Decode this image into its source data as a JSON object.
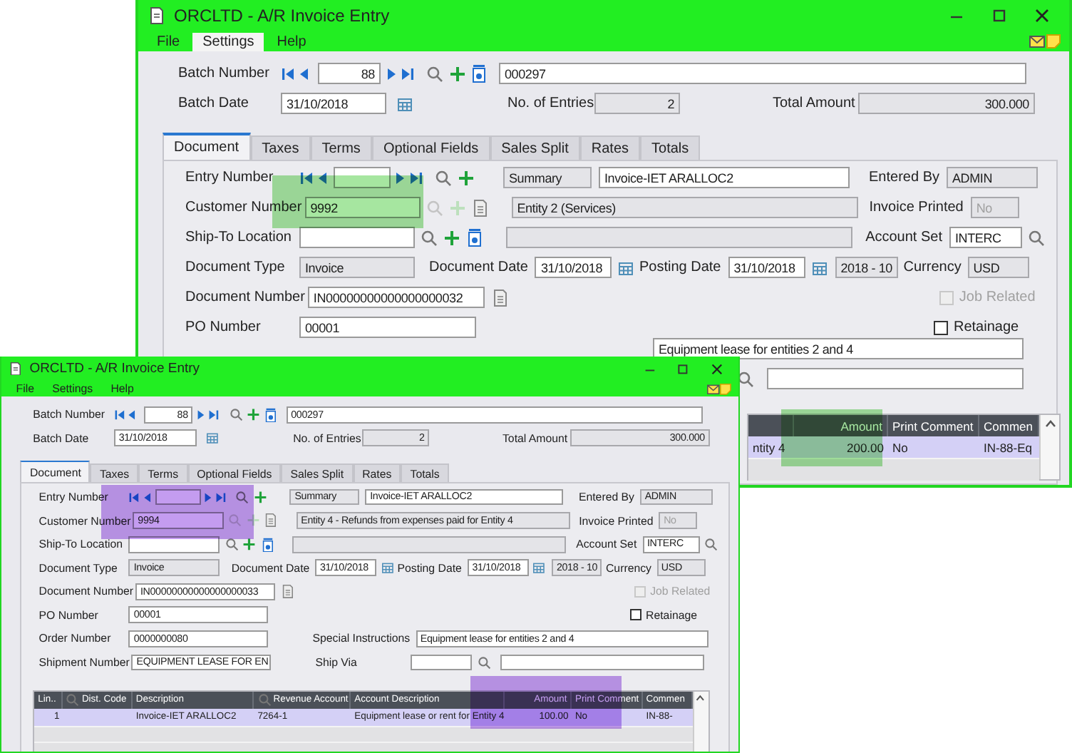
{
  "windows": [
    {
      "kind": "partial",
      "color": "#a6e6a0",
      "title": "ORCLTD - A/R Invoice Entry",
      "menu": [
        {
          "label": "File",
          "selected": false
        },
        {
          "label": "Settings",
          "selected": true
        },
        {
          "label": "Help",
          "selected": false
        }
      ],
      "batch": {
        "number_label": "Batch Number",
        "number": "88",
        "description": "000297",
        "date_label": "Batch Date",
        "date": "31/10/2018",
        "entries_label": "No. of Entries",
        "entries": "2",
        "total_label": "Total Amount",
        "total": "300.000"
      },
      "tabs": [
        {
          "label": "Document",
          "selected": true
        },
        {
          "label": "Taxes",
          "selected": false
        },
        {
          "label": "Terms",
          "selected": false
        },
        {
          "label": "Optional Fields",
          "selected": false
        },
        {
          "label": "Sales Split",
          "selected": false
        },
        {
          "label": "Rates",
          "selected": false
        },
        {
          "label": "Totals",
          "selected": false
        }
      ],
      "document": {
        "entry_number": {
          "label": "Entry Number"
        },
        "summary_label": "Summary",
        "summary": "Invoice-IET ARALLOC2",
        "entered_by": {
          "label": "Entered By",
          "value": "ADMIN"
        },
        "customer_number": {
          "label": "Customer Number",
          "value": "9992"
        },
        "customer_name": "Entity 2 (Services)",
        "invoice_printed": {
          "label": "Invoice Printed",
          "value": "No",
          "disabled": true
        },
        "ship_to": {
          "label": "Ship-To Location"
        },
        "account_set": {
          "label": "Account Set",
          "value": "INTERC"
        },
        "document_type": {
          "label": "Document Type",
          "value": "Invoice"
        },
        "document_date": {
          "label": "Document Date",
          "value": "31/10/2018"
        },
        "posting_date": {
          "label": "Posting Date",
          "value": "31/10/2018"
        },
        "period": "2018 - 10",
        "currency": {
          "label": "Currency",
          "value": "USD"
        },
        "document_number": {
          "label": "Document Number",
          "value": "IN00000000000000000032"
        },
        "job_related": {
          "label": "Job Related",
          "checked": false,
          "disabled": true
        },
        "po_number": {
          "label": "PO Number",
          "value": "00001"
        },
        "retainage": {
          "label": "Retainage",
          "checked": false
        },
        "special_instructions": {
          "value": "Equipment lease for entities 2 and 4"
        }
      },
      "grid": {
        "columns": [
          {
            "lookup": false
          },
          {
            "label": "Amount",
            "lookup": false
          },
          {
            "label": "Print Comment",
            "lookup": false
          },
          {
            "label": "Commen",
            "lookup": false
          }
        ],
        "rows": [
          {
            "selected": true,
            "cells": [
              "ntity 4",
              "200.00",
              "No",
              "IN-88-Eq"
            ]
          }
        ]
      }
    },
    {
      "kind": "full",
      "color": "#c49cf0",
      "title": "ORCLTD - A/R Invoice Entry",
      "menu": [
        {
          "label": "File",
          "selected": false
        },
        {
          "label": "Settings",
          "selected": false
        },
        {
          "label": "Help",
          "selected": false
        }
      ],
      "batch": {
        "number_label": "Batch Number",
        "number": "88",
        "description": "000297",
        "date_label": "Batch Date",
        "date": "31/10/2018",
        "entries_label": "No. of Entries",
        "entries": "2",
        "total_label": "Total Amount",
        "total": "300.000"
      },
      "tabs": [
        {
          "label": "Document",
          "selected": true
        },
        {
          "label": "Taxes",
          "selected": false
        },
        {
          "label": "Terms",
          "selected": false
        },
        {
          "label": "Optional Fields",
          "selected": false
        },
        {
          "label": "Sales Split",
          "selected": false
        },
        {
          "label": "Rates",
          "selected": false
        },
        {
          "label": "Totals",
          "selected": false
        }
      ],
      "document": {
        "entry_number": {
          "label": "Entry Number"
        },
        "summary_label": "Summary",
        "summary": "Invoice-IET ARALLOC2",
        "entered_by": {
          "label": "Entered By",
          "value": "ADMIN"
        },
        "customer_number": {
          "label": "Customer Number",
          "value": "9994"
        },
        "customer_name": "Entity 4 - Refunds from expenses paid for Entity 4",
        "invoice_printed": {
          "label": "Invoice Printed",
          "value": "No",
          "disabled": true
        },
        "ship_to": {
          "label": "Ship-To Location"
        },
        "account_set": {
          "label": "Account Set",
          "value": "INTERC"
        },
        "document_type": {
          "label": "Document Type",
          "value": "Invoice"
        },
        "document_date": {
          "label": "Document Date",
          "value": "31/10/2018"
        },
        "posting_date": {
          "label": "Posting Date",
          "value": "31/10/2018"
        },
        "period": "2018 - 10",
        "currency": {
          "label": "Currency",
          "value": "USD"
        },
        "document_number": {
          "label": "Document Number",
          "value": "IN00000000000000000033"
        },
        "job_related": {
          "label": "Job Related",
          "checked": false,
          "disabled": true
        },
        "po_number": {
          "label": "PO Number",
          "value": "00001"
        },
        "retainage": {
          "label": "Retainage",
          "checked": false
        },
        "order_number": {
          "label": "Order Number",
          "value": "0000000080"
        },
        "special_instructions": {
          "label": "Special Instructions",
          "value": "Equipment lease for entities 2 and 4"
        },
        "shipment_number": {
          "label": "Shipment Number",
          "value": "EQUIPMENT LEASE FOR EN"
        },
        "ship_via": {
          "label": "Ship Via"
        }
      },
      "grid": {
        "columns": [
          {
            "label": "Lin..",
            "lookup": false
          },
          {
            "label": "Dist. Code",
            "lookup": true
          },
          {
            "label": "Description",
            "lookup": false
          },
          {
            "label": "Revenue Account",
            "lookup": true
          },
          {
            "label": "Account Description",
            "lookup": false
          },
          {
            "label": "Amount",
            "lookup": false
          },
          {
            "label": "Print Comment",
            "lookup": false
          },
          {
            "label": "Commen",
            "lookup": false
          }
        ],
        "rows": [
          {
            "selected": true,
            "cells": [
              "1",
              null,
              "Invoice-IET ARALLOC2",
              "7264-1",
              "Equipment lease or rent for Entity 4",
              "100.00",
              "No",
              "IN-88-"
            ]
          }
        ]
      }
    }
  ]
}
